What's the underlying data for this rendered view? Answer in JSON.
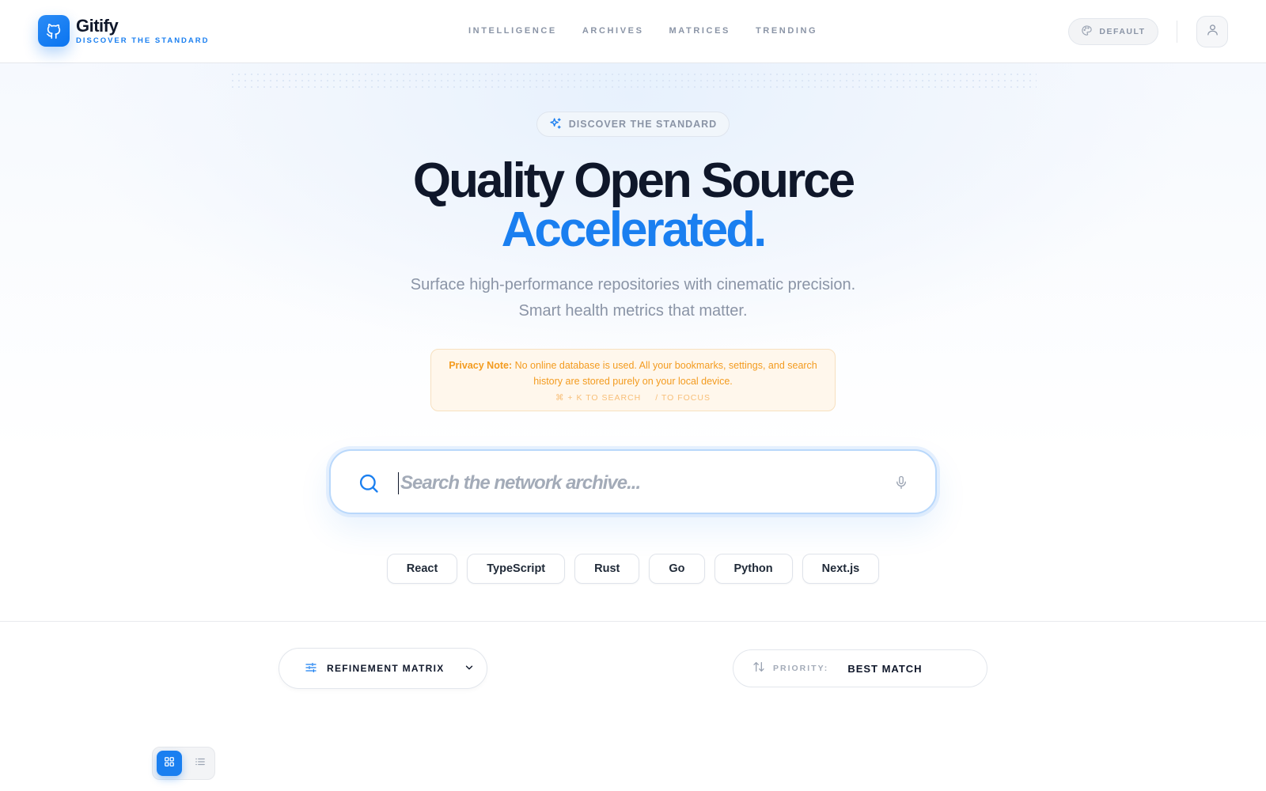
{
  "brand": {
    "name": "Gitify",
    "tagline": "DISCOVER THE STANDARD"
  },
  "nav": {
    "items": [
      "INTELLIGENCE",
      "ARCHIVES",
      "MATRICES",
      "TRENDING"
    ]
  },
  "header": {
    "theme_label": "DEFAULT"
  },
  "hero": {
    "badge": "DISCOVER THE STANDARD",
    "headline": "Quality Open Source",
    "headline_accent": "Accelerated.",
    "subtitle_line1": "Surface high-performance repositories with cinematic precision.",
    "subtitle_line2": "Smart health metrics that matter."
  },
  "privacy": {
    "label": "Privacy Note:",
    "text": " No online database is used. All your bookmarks, settings, and search history are stored purely on your local device.",
    "hint_search": "⌘ + K TO SEARCH",
    "hint_focus": "/ TO FOCUS"
  },
  "search": {
    "placeholder": "Search the network archive...",
    "value": ""
  },
  "quick_tags": [
    "React",
    "TypeScript",
    "Rust",
    "Go",
    "Python",
    "Next.js"
  ],
  "controls": {
    "refinement_label": "REFINEMENT MATRIX",
    "priority_label": "PRIORITY:",
    "priority_value": "BEST MATCH"
  },
  "view": {
    "active": "grid"
  },
  "colors": {
    "accent": "#1a7ff0",
    "text": "#0f172a",
    "muted": "#8a94a6",
    "privacy": "#f39b1f"
  }
}
